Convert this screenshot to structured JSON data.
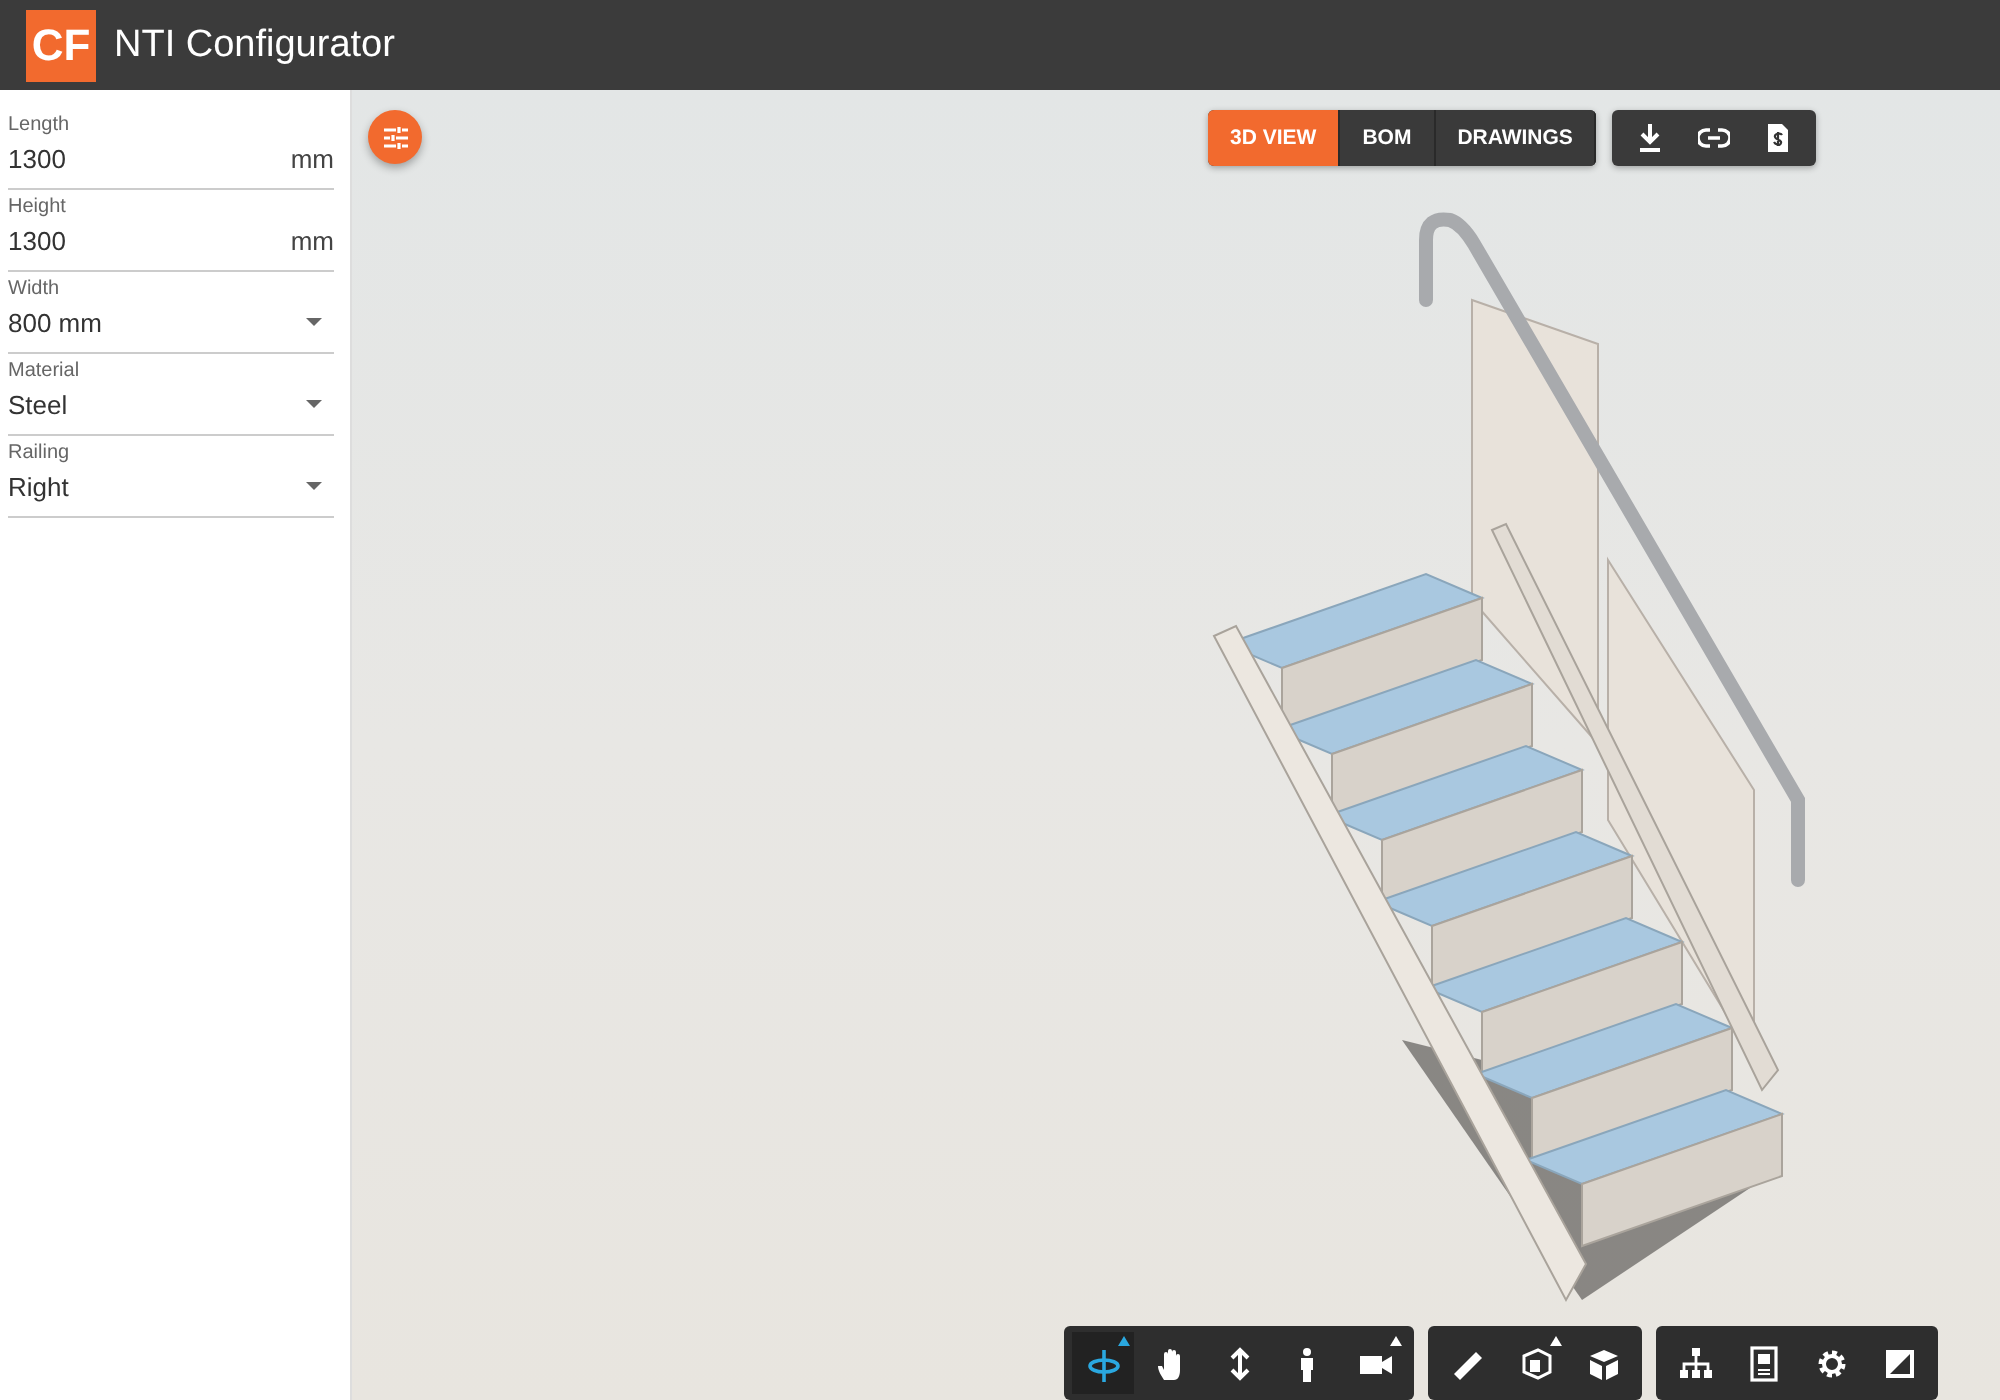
{
  "app": {
    "logo": "CF",
    "title": "NTI Configurator"
  },
  "fields": [
    {
      "label": "Length",
      "value": "1300",
      "unit": "mm",
      "kind": "number"
    },
    {
      "label": "Height",
      "value": "1300",
      "unit": "mm",
      "kind": "number"
    },
    {
      "label": "Width",
      "value": "800 mm",
      "kind": "select"
    },
    {
      "label": "Material",
      "value": "Steel",
      "kind": "select"
    },
    {
      "label": "Railing",
      "value": "Right",
      "kind": "select"
    }
  ],
  "view_tabs": [
    {
      "label": "3D VIEW",
      "selected": true
    },
    {
      "label": "BOM",
      "selected": false
    },
    {
      "label": "DRAWINGS",
      "selected": false
    }
  ],
  "tool_groups": [
    [
      {
        "selected": true,
        "submenu": true
      },
      {
        "selected": false,
        "submenu": false
      },
      {
        "selected": false,
        "submenu": false
      },
      {
        "selected": false,
        "submenu": false
      },
      {
        "selected": false,
        "submenu": true
      }
    ],
    [
      {
        "selected": false,
        "submenu": false
      },
      {
        "selected": false,
        "submenu": true
      },
      {
        "selected": false,
        "submenu": false
      }
    ],
    [
      {
        "selected": false,
        "submenu": false
      },
      {
        "selected": false,
        "submenu": false
      },
      {
        "selected": false,
        "submenu": false
      },
      {
        "selected": false,
        "submenu": false
      }
    ]
  ]
}
